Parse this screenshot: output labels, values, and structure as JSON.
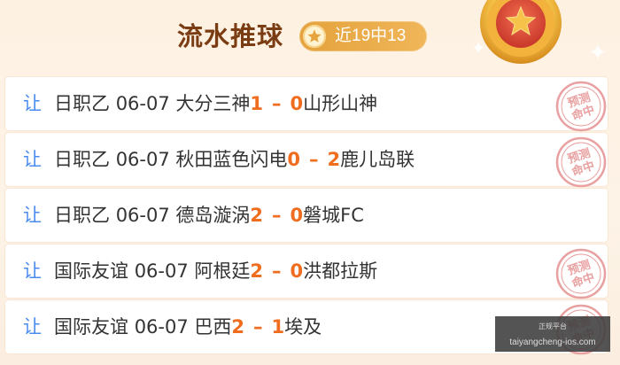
{
  "header": {
    "title": "流水推球",
    "badge_text": "近19中13"
  },
  "stamp_text": [
    "预测",
    "命中"
  ],
  "rows": [
    {
      "tag": "让",
      "league": "日职乙",
      "date": "06-07",
      "home": "大分三神",
      "home_score": "1",
      "away_score": "0",
      "away": "山形山神",
      "hit": true
    },
    {
      "tag": "让",
      "league": "日职乙",
      "date": "06-07",
      "home": "秋田蓝色闪电",
      "home_score": "0",
      "away_score": "2",
      "away": "鹿儿岛联",
      "hit": true
    },
    {
      "tag": "让",
      "league": "日职乙",
      "date": "06-07",
      "home": "德岛漩涡",
      "home_score": "2",
      "away_score": "0",
      "away": "磐城FC",
      "hit": false
    },
    {
      "tag": "让",
      "league": "国际友谊",
      "date": "06-07",
      "home": "阿根廷",
      "home_score": "2",
      "away_score": "0",
      "away": "洪都拉斯",
      "hit": true
    },
    {
      "tag": "让",
      "league": "国际友谊",
      "date": "06-07",
      "home": "巴西",
      "home_score": "2",
      "away_score": "1",
      "away": "埃及",
      "hit": true
    }
  ],
  "dash": "–",
  "watermark": {
    "top": "正规平台",
    "bottom": "taiyangcheng-ios.com"
  },
  "colors": {
    "title": "#7a3c12",
    "badge": "#e9a846",
    "tag": "#4a8bf0",
    "score": "#f06c1e",
    "stamp": "#e9a0a0"
  }
}
